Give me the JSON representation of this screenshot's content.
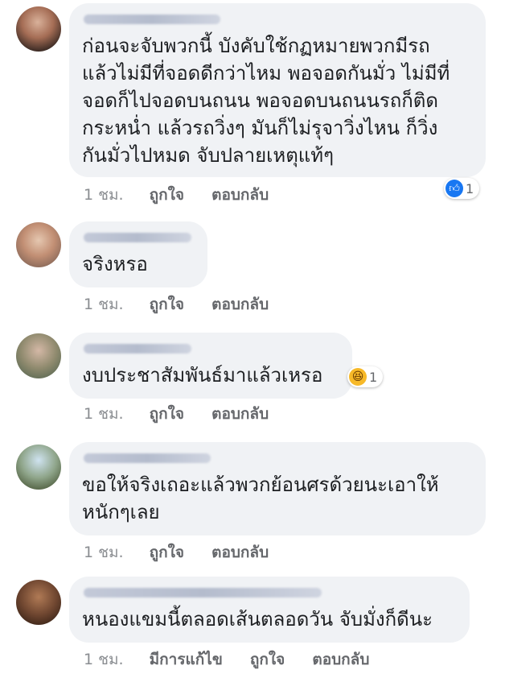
{
  "comments": [
    {
      "lines": [
        "ก่อนจะจับพวกนี้ บังคับใช้กฏหมายพวกมีรถ",
        "แล้วไม่มีที่จอดดีกว่าไหม พอจอดกันมั่ว ไม่มีที่",
        "จอดก็ไปจอดบนถนน พอจอดบนถนนรถก็ติด",
        "กระหน่ำ แล้วรถวิ่งๆ มันก็ไม่รุจาวิ่งไหน ก็วิ่ง",
        "กันมั่วไปหมด จับปลายเหตุแท้ๆ"
      ],
      "time": "1 ชม.",
      "actions": [
        "ถูกใจ",
        "ตอบกลับ"
      ],
      "reaction": {
        "icon": "like-icon",
        "count": "1"
      }
    },
    {
      "lines": [
        "จริงหรอ"
      ],
      "time": "1 ชม.",
      "actions": [
        "ถูกใจ",
        "ตอบกลับ"
      ]
    },
    {
      "lines": [
        "งบประชาสัมพันธ์มาแล้วเหรอ"
      ],
      "time": "1 ชม.",
      "actions": [
        "ถูกใจ",
        "ตอบกลับ"
      ],
      "reaction": {
        "icon": "haha-icon",
        "count": "1"
      }
    },
    {
      "lines": [
        "ขอให้จริงเถอะแล้วพวกย้อนศรด้วยนะเอาให้",
        "หนักๆเลย"
      ],
      "time": "1 ชม.",
      "actions": [
        "ถูกใจ",
        "ตอบกลับ"
      ]
    },
    {
      "lines": [
        "หนองแขมนี้ตลอดเส้นตลอดวัน จับมั่งก็ดีนะ"
      ],
      "time": "1 ชม.",
      "actions": [
        "มีการแก้ไข",
        "ถูกใจ",
        "ตอบกลับ"
      ]
    }
  ],
  "colors": {
    "bubble": "#f0f2f5",
    "like": "#1877f2",
    "haha": "#f7b928",
    "meta": "#65676b"
  }
}
